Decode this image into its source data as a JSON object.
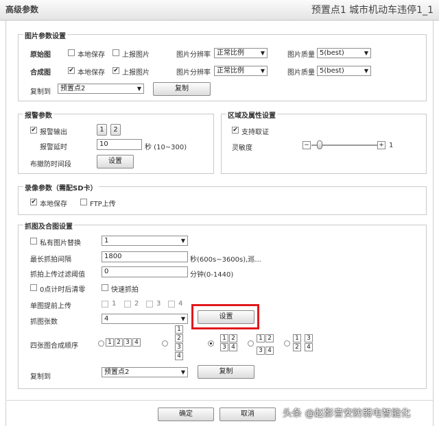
{
  "window": {
    "title": "高级参数",
    "subtitle": "预置点1 城市机动车违停1_1"
  },
  "pic": {
    "legend": "图片参数设置",
    "row1": {
      "label": "原始图",
      "local_save": "本地保存",
      "upload": "上报图片",
      "res_label": "图片分辨率",
      "res": "正常比例",
      "quality_label": "图片质量",
      "quality": "5(best)"
    },
    "row2": {
      "label": "合成图",
      "local_save": "本地保存",
      "upload": "上报图片",
      "res_label": "图片分辨率",
      "res": "正常比例",
      "quality_label": "图片质量",
      "quality": "5(best)"
    },
    "copy_label": "复制到",
    "copy_target": "预置点2",
    "copy_btn": "复制"
  },
  "alarm": {
    "legend": "报警参数",
    "output": "报警输出",
    "ch1": "1",
    "ch2": "2",
    "delay_label": "报警延时",
    "delay": "10",
    "delay_unit": "秒 (10~300)",
    "schedule_label": "布撤防时间段",
    "schedule_btn": "设置"
  },
  "region": {
    "legend": "区域及属性设置",
    "evidence": "支持取证",
    "sens_label": "灵敏度",
    "minus": "−",
    "plus": "+",
    "sens_val": "1"
  },
  "record": {
    "legend": "录像参数（需配SD卡）",
    "local": "本地保存",
    "ftp": "FTP上传"
  },
  "capture": {
    "legend": "抓图及合图设置",
    "private_label": "私有图片替换",
    "private_val": "1",
    "interval_label": "最长抓拍间隔",
    "interval": "1800",
    "interval_unit": "秒(600s~3600s),巡...",
    "filter_label": "抓拍上传过滤阈值",
    "filter": "0",
    "filter_unit": "分钟(0-1440)",
    "zero_clear": "0点计时后清零",
    "fast": "快速抓拍",
    "pre_upload_label": "单图提前上传",
    "pre_opts": [
      "1",
      "2",
      "3",
      "4"
    ],
    "count_label": "抓图张数",
    "count": "4",
    "count_btn": "设置",
    "order_label": "四张图合成顺序",
    "copy_label": "复制到",
    "copy_target": "预置点2",
    "copy_btn": "复制"
  },
  "footer": {
    "ok": "确定",
    "cancel": "取消"
  },
  "watermark": "头条 @赵影音安防弱电智能化"
}
